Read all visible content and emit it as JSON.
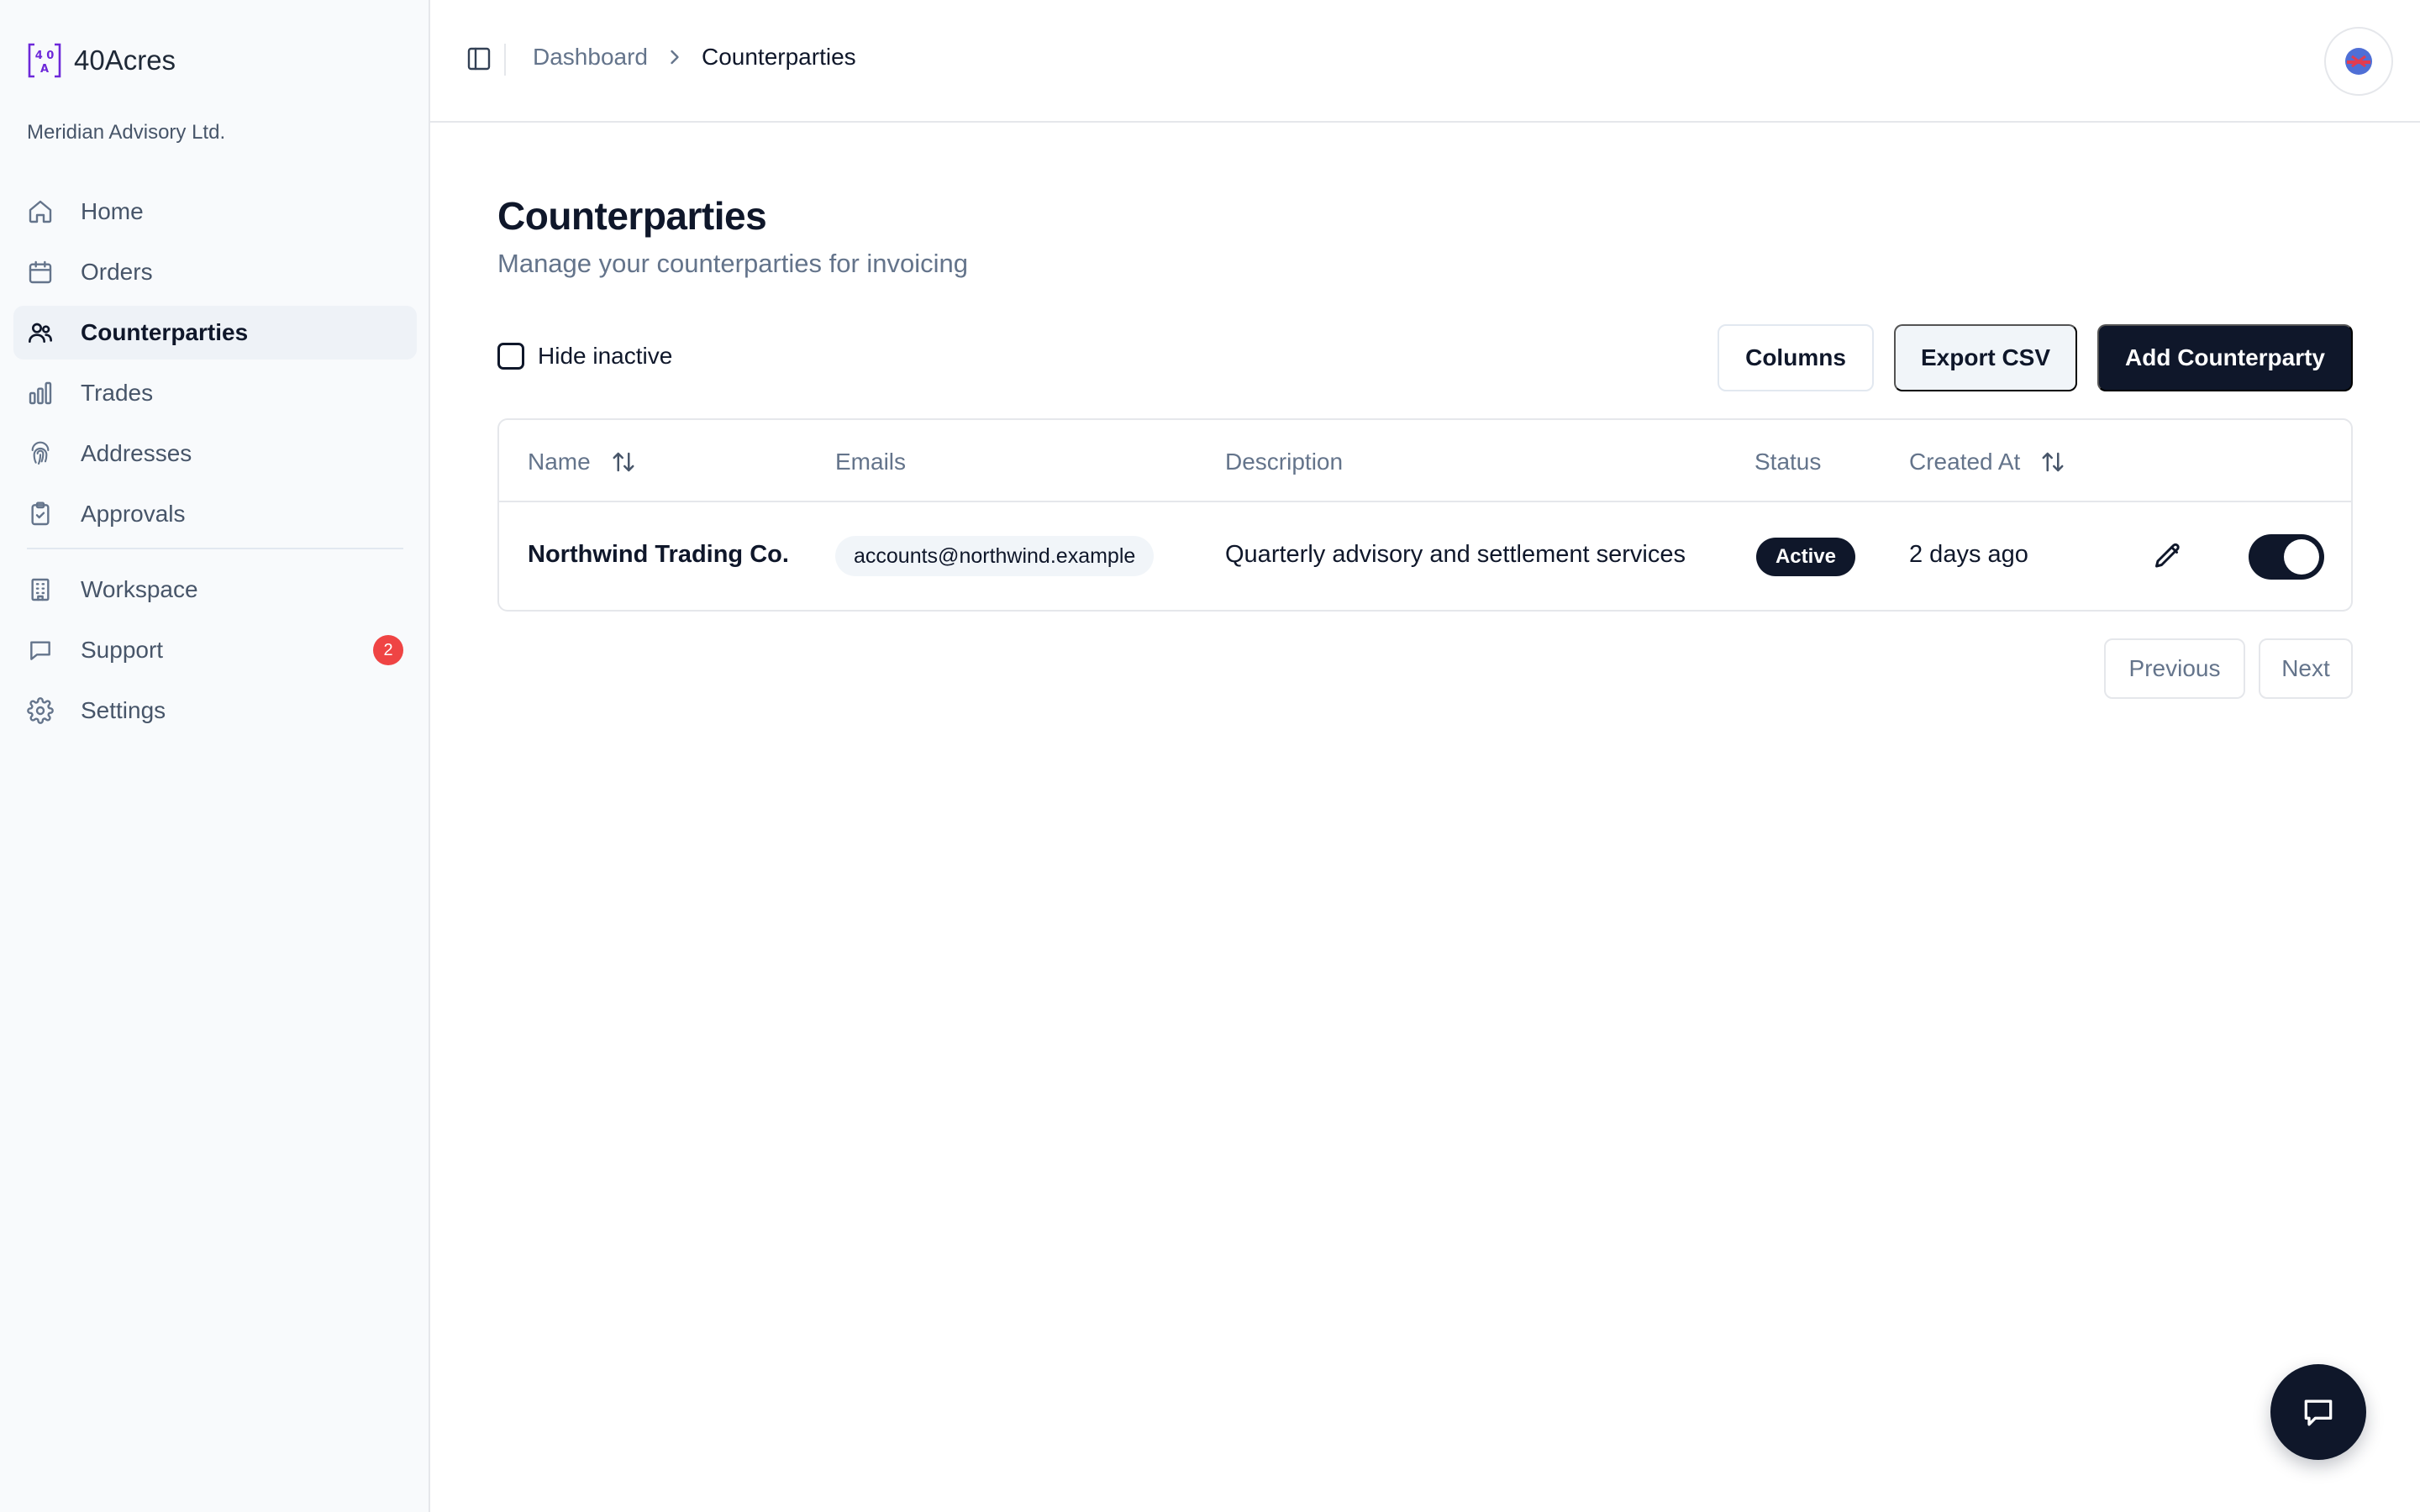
{
  "brand": {
    "name": "40Acres",
    "organization": "Meridian Advisory Ltd."
  },
  "sidebar": {
    "items": [
      {
        "label": "Home",
        "icon": "home-icon"
      },
      {
        "label": "Orders",
        "icon": "calendar-icon"
      },
      {
        "label": "Counterparties",
        "icon": "users-icon",
        "active": true
      },
      {
        "label": "Trades",
        "icon": "bar-chart-icon"
      },
      {
        "label": "Addresses",
        "icon": "fingerprint-icon"
      },
      {
        "label": "Approvals",
        "icon": "clipboard-check-icon"
      },
      {
        "label": "Workspace",
        "icon": "building-icon"
      },
      {
        "label": "Support",
        "icon": "message-icon",
        "badge": "2"
      },
      {
        "label": "Settings",
        "icon": "gear-icon"
      }
    ]
  },
  "header": {
    "breadcrumb": {
      "parent": "Dashboard",
      "current": "Counterparties"
    }
  },
  "page": {
    "title": "Counterparties",
    "subtitle": "Manage your counterparties for invoicing"
  },
  "toolbar": {
    "hide_inactive_label": "Hide inactive",
    "hide_inactive_checked": false,
    "columns_label": "Columns",
    "export_label": "Export CSV",
    "add_label": "Add Counterparty"
  },
  "table": {
    "columns": [
      "Name",
      "Emails",
      "Description",
      "Status",
      "Created At"
    ],
    "rows": [
      {
        "name": "Northwind Trading Co.",
        "email": "accounts@northwind.example",
        "description": "Quarterly advisory and settlement services",
        "status": "Active",
        "created_at": "2 days ago",
        "enabled": true
      }
    ]
  },
  "pagination": {
    "previous_label": "Previous",
    "next_label": "Next"
  },
  "colors": {
    "primary": "#0f172a",
    "brand_purple": "#6d28d9",
    "badge_red": "#ef4444",
    "muted_text": "#64748b",
    "sidebar_bg": "#f8fafc"
  }
}
